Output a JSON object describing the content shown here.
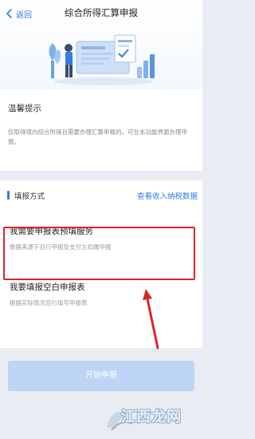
{
  "header": {
    "back_label": "返回",
    "title": "综合所得汇算申报"
  },
  "tips": {
    "title": "温馨提示",
    "text": "仅取得境内综合所得且需要办理汇算申报的，可在本功能界面办理申报。"
  },
  "method": {
    "title": "填报方式",
    "view_link": "查看收入纳税数据",
    "options": [
      {
        "title": "我需要申报表预填服务",
        "subtitle": "数据来源于自行申报及支付方扣缴申报"
      },
      {
        "title": "我要填报空白申报表",
        "subtitle": "根据实际情况自行填写申报表"
      }
    ]
  },
  "actions": {
    "start_label": "开始申报"
  },
  "watermark": {
    "text": "江西龙网"
  },
  "colors": {
    "accent": "#2f7de1",
    "highlight": "#d7262b",
    "button_disabled": "#bdd4f5"
  }
}
